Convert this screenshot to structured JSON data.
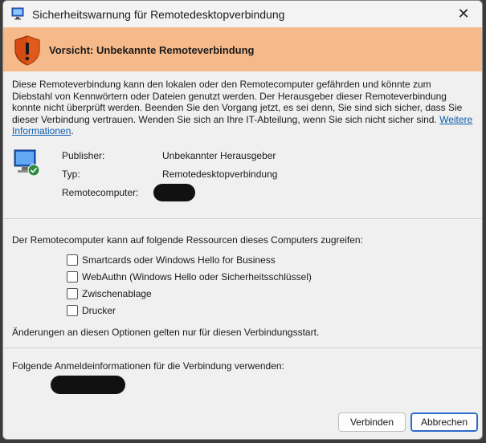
{
  "window": {
    "title": "Sicherheitswarnung für Remotedesktopverbindung",
    "close_glyph": "✕"
  },
  "banner": {
    "text": "Vorsicht: Unbekannte Remoteverbindung",
    "color": "#f6b98a"
  },
  "intro": {
    "text": "Diese Remoteverbindung kann den lokalen oder den Remotecomputer gefährden und könnte zum Diebstahl von Kennwörtern oder Dateien genutzt werden. Der Herausgeber dieser Remoteverbindung konnte nicht überprüft werden. Beenden Sie den Vorgang jetzt, es sei denn, Sie sind sich sicher, dass Sie dieser Verbindung vertrauen. Wenden Sie sich an Ihre IT-Abteilung, wenn Sie sich nicht sicher sind.",
    "link": "Weitere Informationen",
    "link_suffix": "."
  },
  "details": {
    "publisher_label": "Publisher:",
    "publisher_value": "Unbekannter Herausgeber",
    "type_label": "Typ:",
    "type_value": "Remotedesktopverbindung",
    "computer_label": "Remotecomputer:"
  },
  "resources": {
    "lead": "Der Remotecomputer kann auf folgende Ressourcen dieses Computers zugreifen:",
    "items": [
      {
        "label": "Smartcards oder Windows Hello for Business",
        "checked": false
      },
      {
        "label": "WebAuthn (Windows Hello oder Sicherheitsschlüssel)",
        "checked": false
      },
      {
        "label": "Zwischenablage",
        "checked": false
      },
      {
        "label": "Drucker",
        "checked": false
      }
    ],
    "note": "Änderungen an diesen Optionen gelten nur für diesen Verbindungsstart."
  },
  "credentials": {
    "lead": "Folgende Anmeldeinformationen für die Verbindung verwenden:"
  },
  "buttons": {
    "connect": "Verbinden",
    "cancel": "Abbrechen"
  }
}
